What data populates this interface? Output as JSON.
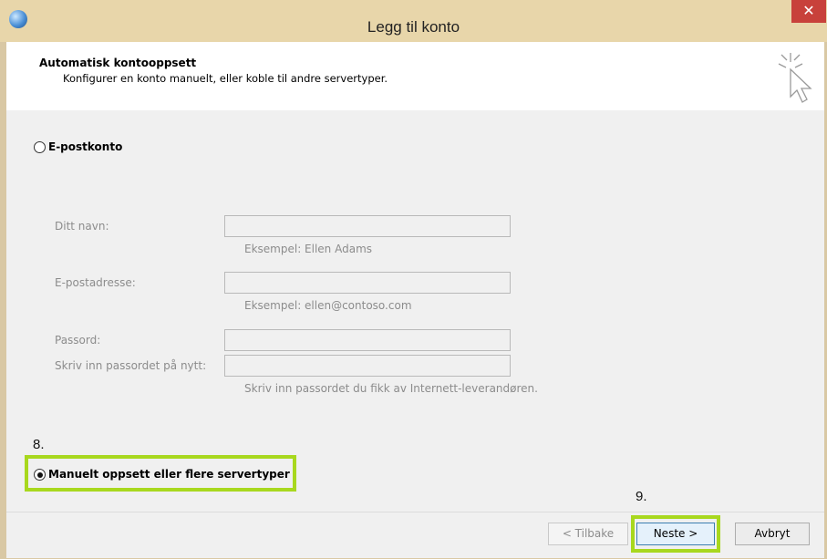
{
  "window": {
    "title": "Legg til konto",
    "close_glyph": "✕"
  },
  "header": {
    "title": "Automatisk kontooppsett",
    "subtitle": "Konfigurer en konto manuelt, eller koble til andre servertyper."
  },
  "options": {
    "email_account": {
      "label": "E-postkonto",
      "selected": false
    },
    "manual": {
      "label": "Manuelt oppsett eller flere servertyper",
      "selected": true
    }
  },
  "form": {
    "name_label": "Ditt navn:",
    "name_hint": "Eksempel: Ellen Adams",
    "email_label": "E-postadresse:",
    "email_hint": "Eksempel: ellen@contoso.com",
    "password_label": "Passord:",
    "retype_label": "Skriv inn passordet på nytt:",
    "password_hint": "Skriv inn passordet du fikk av Internett-leverandøren."
  },
  "annotations": {
    "step8": "8.",
    "step9": "9."
  },
  "buttons": {
    "back": "< Tilbake",
    "next": "Neste >",
    "cancel": "Avbryt"
  },
  "colors": {
    "highlight": "#a8d81e",
    "close": "#c8413b",
    "titlebar": "#e8d6aa"
  },
  "icons": [
    "app-icon",
    "close-icon",
    "cursor-click-icon",
    "radio-icon"
  ]
}
